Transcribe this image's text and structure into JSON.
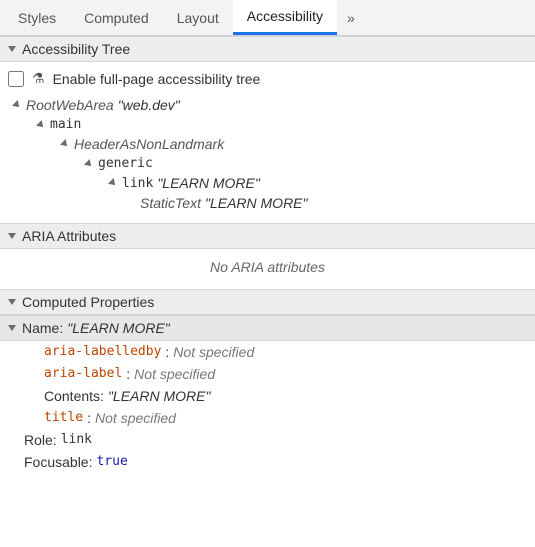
{
  "tabs": {
    "styles": "Styles",
    "computed": "Computed",
    "layout": "Layout",
    "accessibility": "Accessibility",
    "overflow": "»"
  },
  "sections": {
    "tree_header": "Accessibility Tree",
    "enable_label": "Enable full-page accessibility tree",
    "aria_header": "ARIA Attributes",
    "aria_empty": "No ARIA attributes",
    "computed_header": "Computed Properties"
  },
  "tree": {
    "n0": {
      "role": "RootWebArea",
      "label": "\"web.dev\""
    },
    "n1": {
      "role": "main"
    },
    "n2": {
      "role": "HeaderAsNonLandmark"
    },
    "n3": {
      "role": "generic"
    },
    "n4": {
      "role": "link",
      "label": "\"LEARN MORE\""
    },
    "n5": {
      "role": "StaticText",
      "label": "\"LEARN MORE\""
    }
  },
  "computed": {
    "name_label": "Name:",
    "name_value": "\"LEARN MORE\"",
    "aria_labelledby_k": "aria-labelledby",
    "aria_labelledby_v": "Not specified",
    "aria_label_k": "aria-label",
    "aria_label_v": "Not specified",
    "contents_k": "Contents:",
    "contents_v": "\"LEARN MORE\"",
    "title_k": "title",
    "title_v": "Not specified",
    "role_k": "Role:",
    "role_v": "link",
    "focusable_k": "Focusable:",
    "focusable_v": "true"
  }
}
